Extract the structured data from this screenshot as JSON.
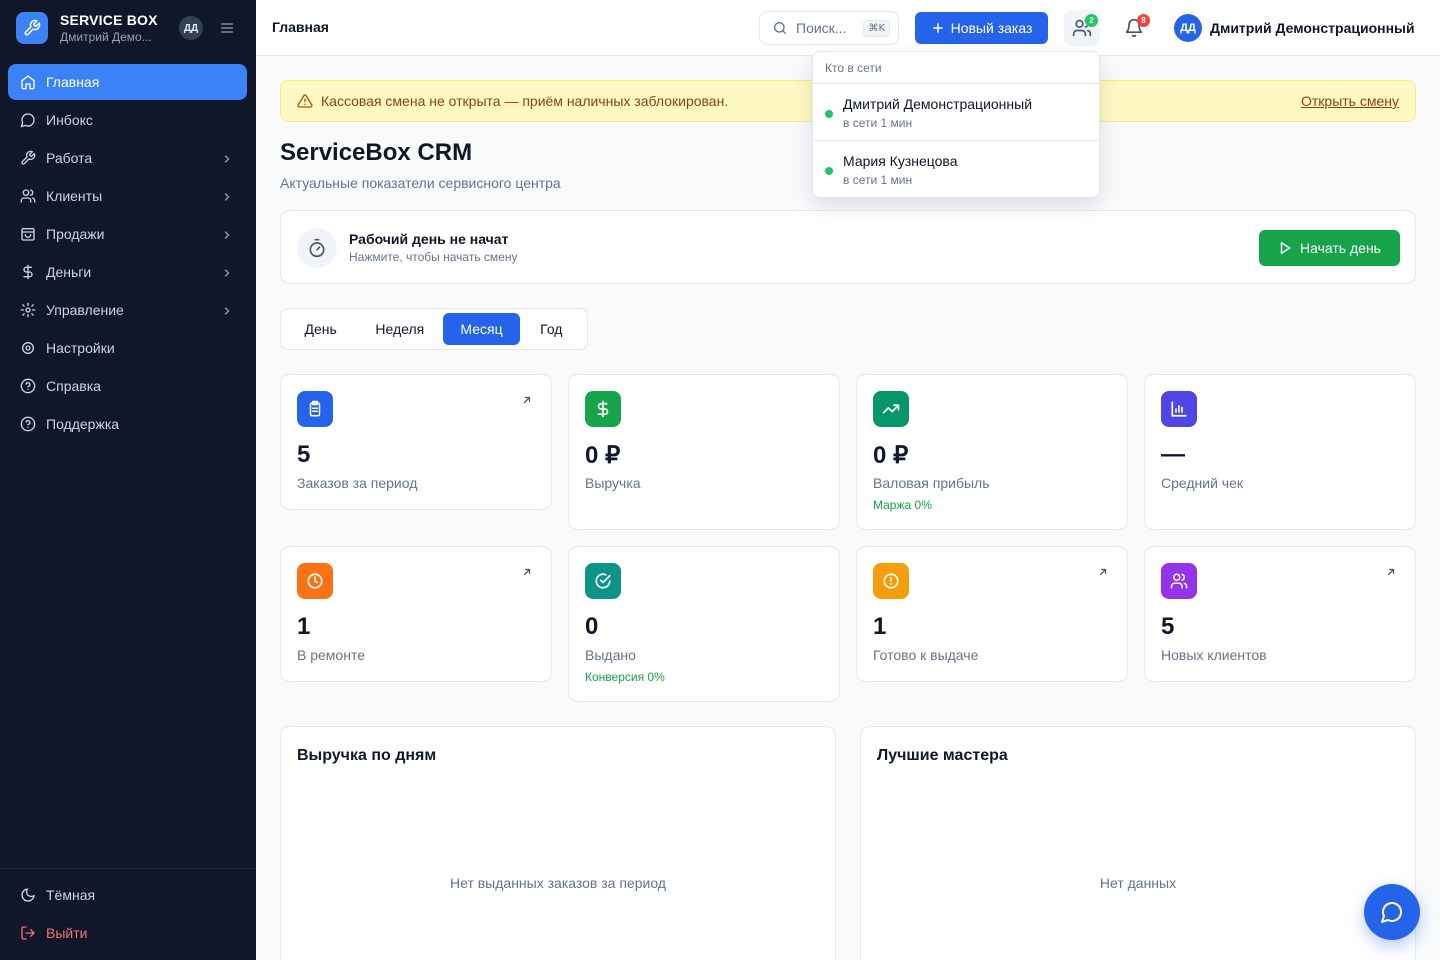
{
  "colors": {
    "accent": "#2563eb",
    "sidebar": "#0f1729",
    "success": "#16a34a",
    "warning_bg": "#fef9c3"
  },
  "sidebar": {
    "brand": "SERVICE BOX",
    "user_short": "Дмитрий Демо...",
    "avatar_initials": "ДД",
    "items": [
      {
        "label": "Главная",
        "icon": "home-icon",
        "active": true
      },
      {
        "label": "Инбокс",
        "icon": "message-icon"
      },
      {
        "label": "Работа",
        "icon": "wrench-icon",
        "chevron": true
      },
      {
        "label": "Клиенты",
        "icon": "users-icon",
        "chevron": true
      },
      {
        "label": "Продажи",
        "icon": "shopping-bag-icon",
        "chevron": true
      },
      {
        "label": "Деньги",
        "icon": "dollar-icon",
        "chevron": true
      },
      {
        "label": "Управление",
        "icon": "gear-icon",
        "chevron": true
      },
      {
        "label": "Настройки",
        "icon": "settings-icon"
      },
      {
        "label": "Справка",
        "icon": "help-icon"
      },
      {
        "label": "Поддержка",
        "icon": "help-circle-icon"
      }
    ],
    "theme_label": "Тёмная",
    "logout_label": "Выйти"
  },
  "header": {
    "title": "Главная",
    "search_placeholder": "Поиск...",
    "search_shortcut": "⌘K",
    "new_order_label": "Новый заказ",
    "online_count": "2",
    "notifications_count": "8",
    "user_initials": "ДД",
    "user_name": "Дмитрий Демонстрационный"
  },
  "online_popup": {
    "title": "Кто в сети",
    "users": [
      {
        "name": "Дмитрий Демонстрационный",
        "status": "в сети 1 мин"
      },
      {
        "name": "Мария Кузнецова",
        "status": "в сети 1 мин"
      }
    ]
  },
  "alert": {
    "text": "Кассовая смена не открыта — приём наличных заблокирован.",
    "link": "Открыть смену"
  },
  "main": {
    "title": "ServiceBox CRM",
    "subtitle": "Актуальные показатели сервисного центра",
    "shift": {
      "title": "Рабочий день не начат",
      "subtitle": "Нажмите, чтобы начать смену",
      "button": "Начать день"
    },
    "periods": [
      "День",
      "Неделя",
      "Месяц",
      "Год"
    ],
    "active_period": "Месяц",
    "stats": [
      {
        "value": "5",
        "label": "Заказов за период",
        "icon": "clipboard-icon",
        "color": "#2563eb",
        "link": true
      },
      {
        "value": "0 ₽",
        "label": "Выручка",
        "icon": "dollar-icon",
        "color": "#16a34a"
      },
      {
        "value": "0 ₽",
        "label": "Валовая прибыль",
        "sub": "Маржа 0%",
        "icon": "trending-up-icon",
        "color": "#059669"
      },
      {
        "value": "—",
        "label": "Средний чек",
        "icon": "bar-chart-icon",
        "color": "#4f46e5"
      },
      {
        "value": "1",
        "label": "В ремонте",
        "icon": "clock-icon",
        "color": "#f97316",
        "link": true
      },
      {
        "value": "0",
        "label": "Выдано",
        "sub": "Конверсия 0%",
        "icon": "check-circle-icon",
        "color": "#0d9488"
      },
      {
        "value": "1",
        "label": "Готово к выдаче",
        "icon": "alert-circle-icon",
        "color": "#f59e0b",
        "link": true
      },
      {
        "value": "5",
        "label": "Новых клиентов",
        "icon": "users-icon",
        "color": "#9333ea",
        "link": true
      }
    ],
    "revenue_panel": {
      "title": "Выручка по дням",
      "empty": "Нет выданных заказов за период"
    },
    "masters_panel": {
      "title": "Лучшие мастера",
      "empty": "Нет данных"
    }
  }
}
